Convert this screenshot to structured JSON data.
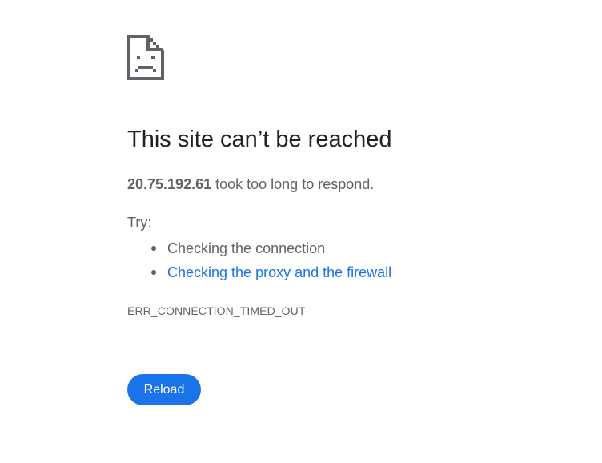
{
  "icon": {
    "name": "sad-page-icon",
    "color": "#5f6368"
  },
  "error": {
    "heading": "This site can’t be reached",
    "host": "20.75.192.61",
    "summary_suffix": " took too long to respond.",
    "try_label": "Try:",
    "suggestions": [
      {
        "label": "Checking the connection",
        "is_link": false
      },
      {
        "label": "Checking the proxy and the firewall",
        "is_link": true
      }
    ],
    "code": "ERR_CONNECTION_TIMED_OUT"
  },
  "actions": {
    "reload_label": "Reload"
  },
  "colors": {
    "accent": "#1a73e8",
    "heading_text": "#202124",
    "body_text": "#5f6368"
  }
}
